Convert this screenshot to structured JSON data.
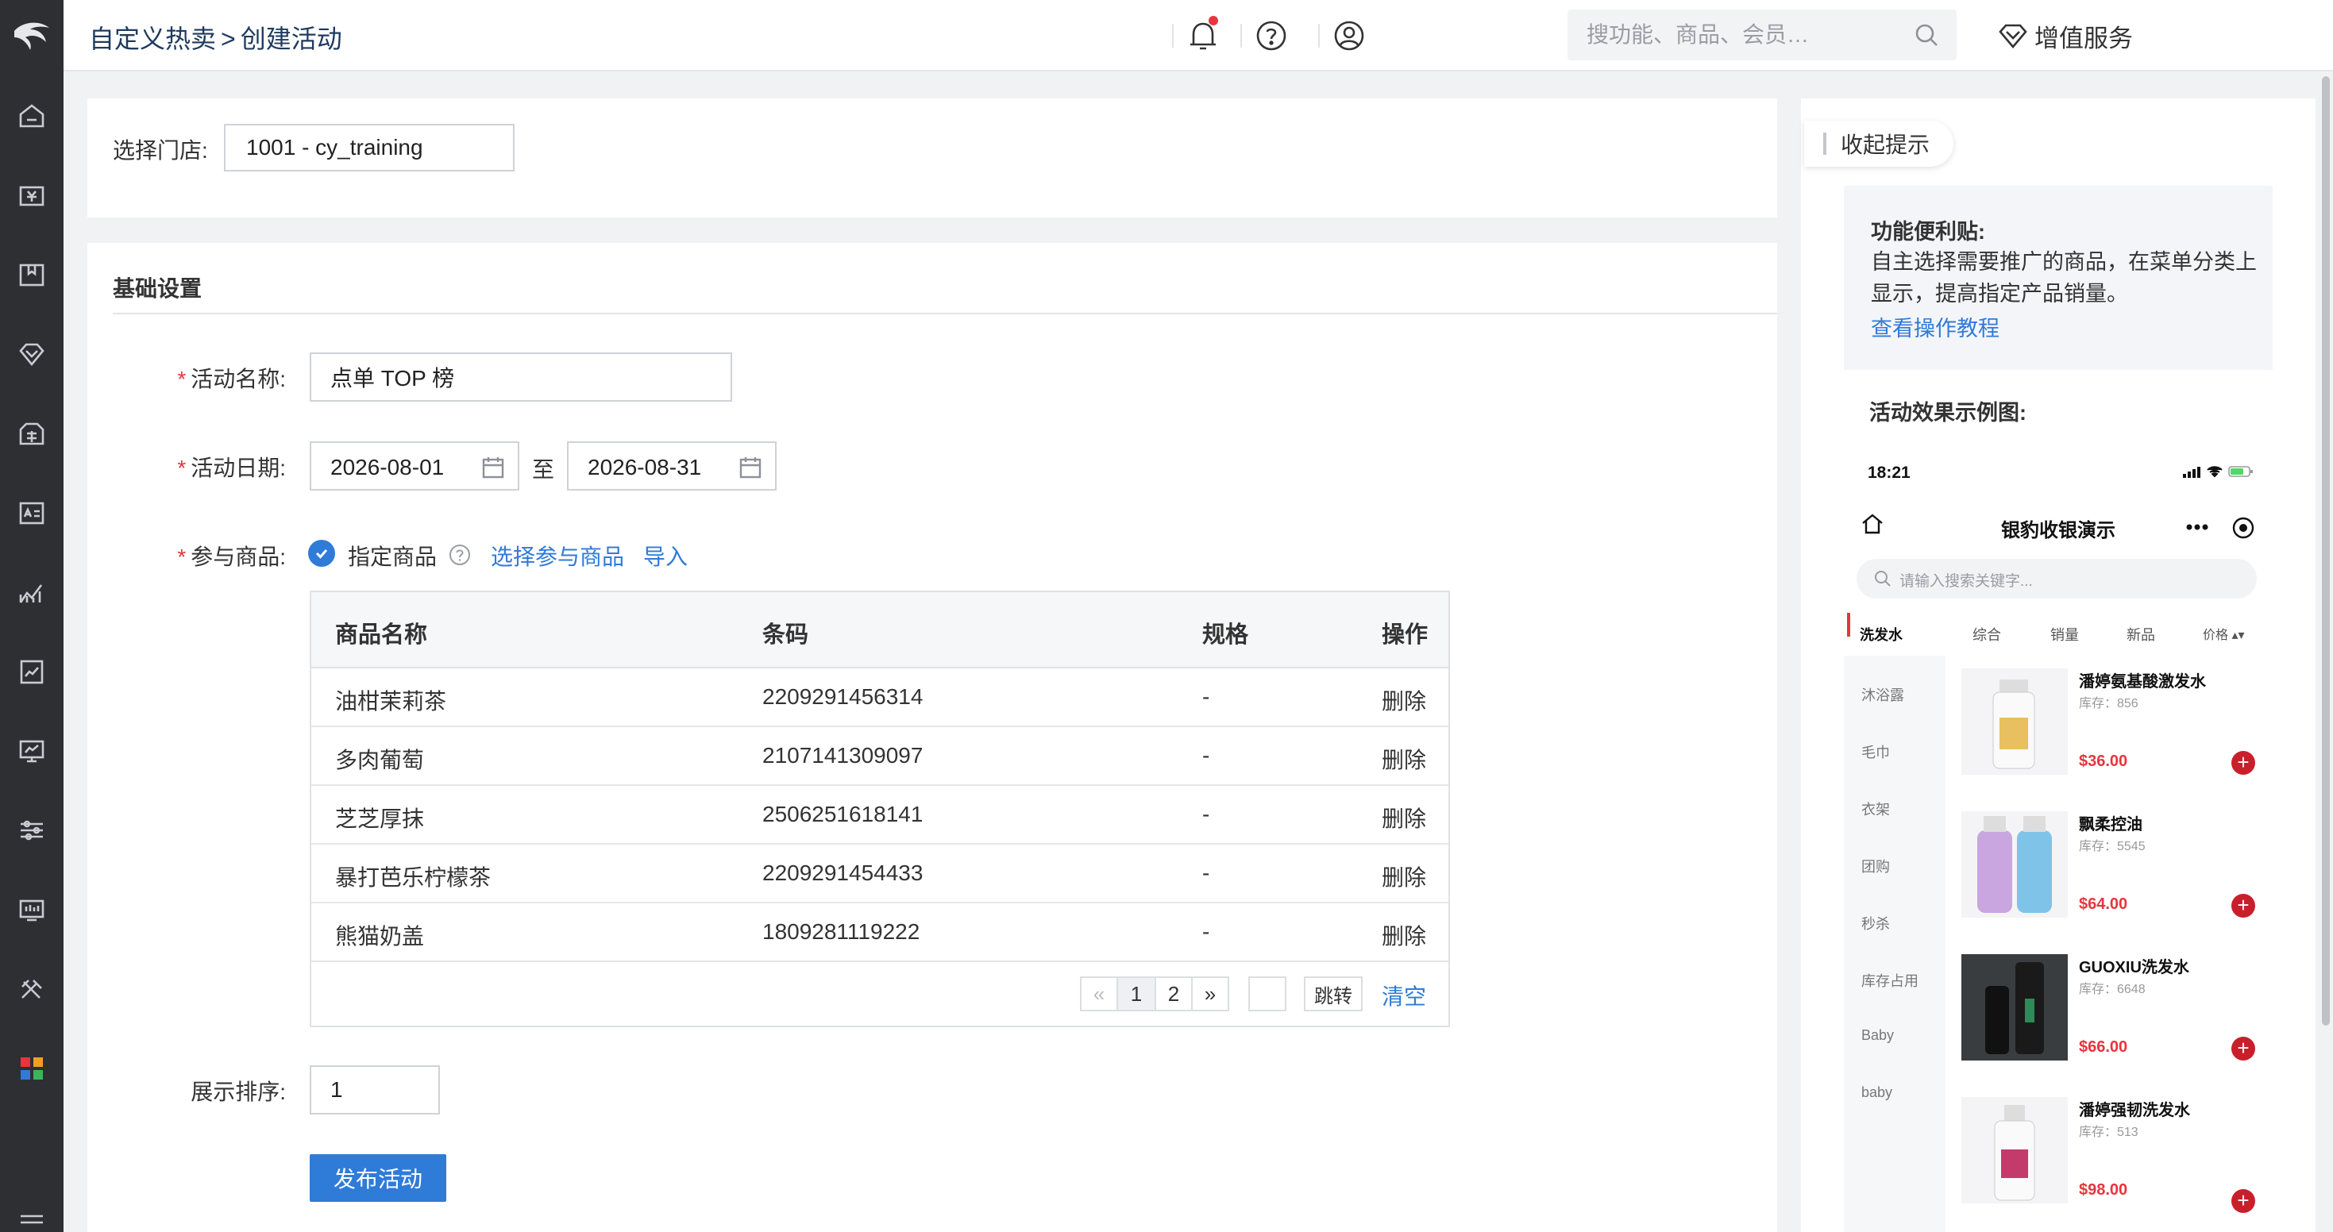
{
  "breadcrumb": {
    "parent": "自定义热卖",
    "separator": ">",
    "current": "创建活动"
  },
  "topbar": {
    "search_placeholder": "搜功能、商品、会员…",
    "value_added_label": "增值服务"
  },
  "store": {
    "label": "选择门店:",
    "value": "1001 - cy_training"
  },
  "basic": {
    "section_title": "基础设置",
    "name_label": "活动名称:",
    "name_value": "点单 TOP 榜",
    "date_label": "活动日期:",
    "date_start": "2026-08-01",
    "date_to": "至",
    "date_end": "2026-08-31",
    "goods_label": "参与商品:",
    "goods_option": "指定商品",
    "select_goods_link": "选择参与商品",
    "import_link": "导入",
    "required_mark": "*"
  },
  "table": {
    "headers": {
      "name": "商品名称",
      "barcode": "条码",
      "spec": "规格",
      "action": "操作"
    },
    "rows": [
      {
        "name": "油柑茉莉茶",
        "barcode": "2209291456314",
        "spec": "-",
        "action": "删除"
      },
      {
        "name": "多肉葡萄",
        "barcode": "2107141309097",
        "spec": "-",
        "action": "删除"
      },
      {
        "name": "芝芝厚抹",
        "barcode": "2506251618141",
        "spec": "-",
        "action": "删除"
      },
      {
        "name": "暴打芭乐柠檬茶",
        "barcode": "2209291454433",
        "spec": "-",
        "action": "删除"
      },
      {
        "name": "熊猫奶盖",
        "barcode": "1809281119222",
        "spec": "-",
        "action": "删除"
      }
    ],
    "pager": {
      "prev": "«",
      "page1": "1",
      "page2": "2",
      "next": "»",
      "jump_label": "跳转",
      "clear_label": "清空",
      "current_page": 1
    }
  },
  "sort": {
    "label": "展示排序:",
    "value": "1"
  },
  "publish_label": "发布活动",
  "tips": {
    "collapse_label": "收起提示",
    "title": "功能便利贴:",
    "text": "自主选择需要推广的商品，在菜单分类上显示，提高指定产品销量。",
    "tutorial_link": "查看操作教程",
    "example_title": "活动效果示例图:"
  },
  "phone": {
    "time": "18:21",
    "title": "银豹收银演示",
    "search_placeholder": "请输入搜索关键字...",
    "tabs": [
      "洗发水",
      "综合",
      "销量",
      "新品",
      "价格 ▴▾"
    ],
    "categories": [
      "沐浴露",
      "毛巾",
      "衣架",
      "团购",
      "秒杀",
      "库存占用",
      "Baby",
      "baby"
    ],
    "products": [
      {
        "name": "潘婷氨基酸激发水",
        "stock": "库存：856",
        "price": "$36.00"
      },
      {
        "name": "飘柔控油",
        "stock": "库存：5545",
        "price": "$64.00"
      },
      {
        "name": "GUOXIU洗发水",
        "stock": "库存：6648",
        "price": "$66.00"
      },
      {
        "name": "潘婷强韧洗发水",
        "stock": "库存：513",
        "price": "$98.00"
      }
    ]
  },
  "colors": {
    "primary": "#2f7bd8",
    "required": "#e8343e",
    "rail": "#2e2f33",
    "price": "#e8343e"
  }
}
